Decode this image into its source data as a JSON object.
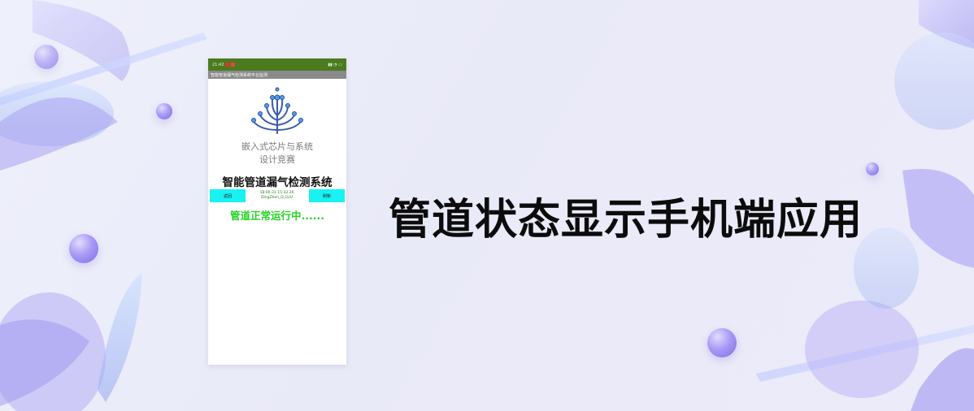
{
  "phone": {
    "statusbar": {
      "time": "21:42",
      "right": "▮▮ ◔ ▭"
    },
    "app_title": "智能管道漏气检测系统平台监测",
    "subtitle_line1": "嵌入式芯片与系统",
    "subtitle_line2": "设计竞赛",
    "system_title": "智能管道漏气检测系统",
    "left_button": "返回",
    "right_button": "刷新",
    "timestamp_line1": "18:00:31 15:33:26",
    "timestamp_line2": "DingZhen_D_LUU",
    "status": "管道正常运行中......"
  },
  "headline": "管道状态显示手机端应用",
  "colors": {
    "statusbar": "#4b7a1f",
    "button": "#18f2f2",
    "status_green": "#27d227",
    "background": "#eef0fb"
  }
}
